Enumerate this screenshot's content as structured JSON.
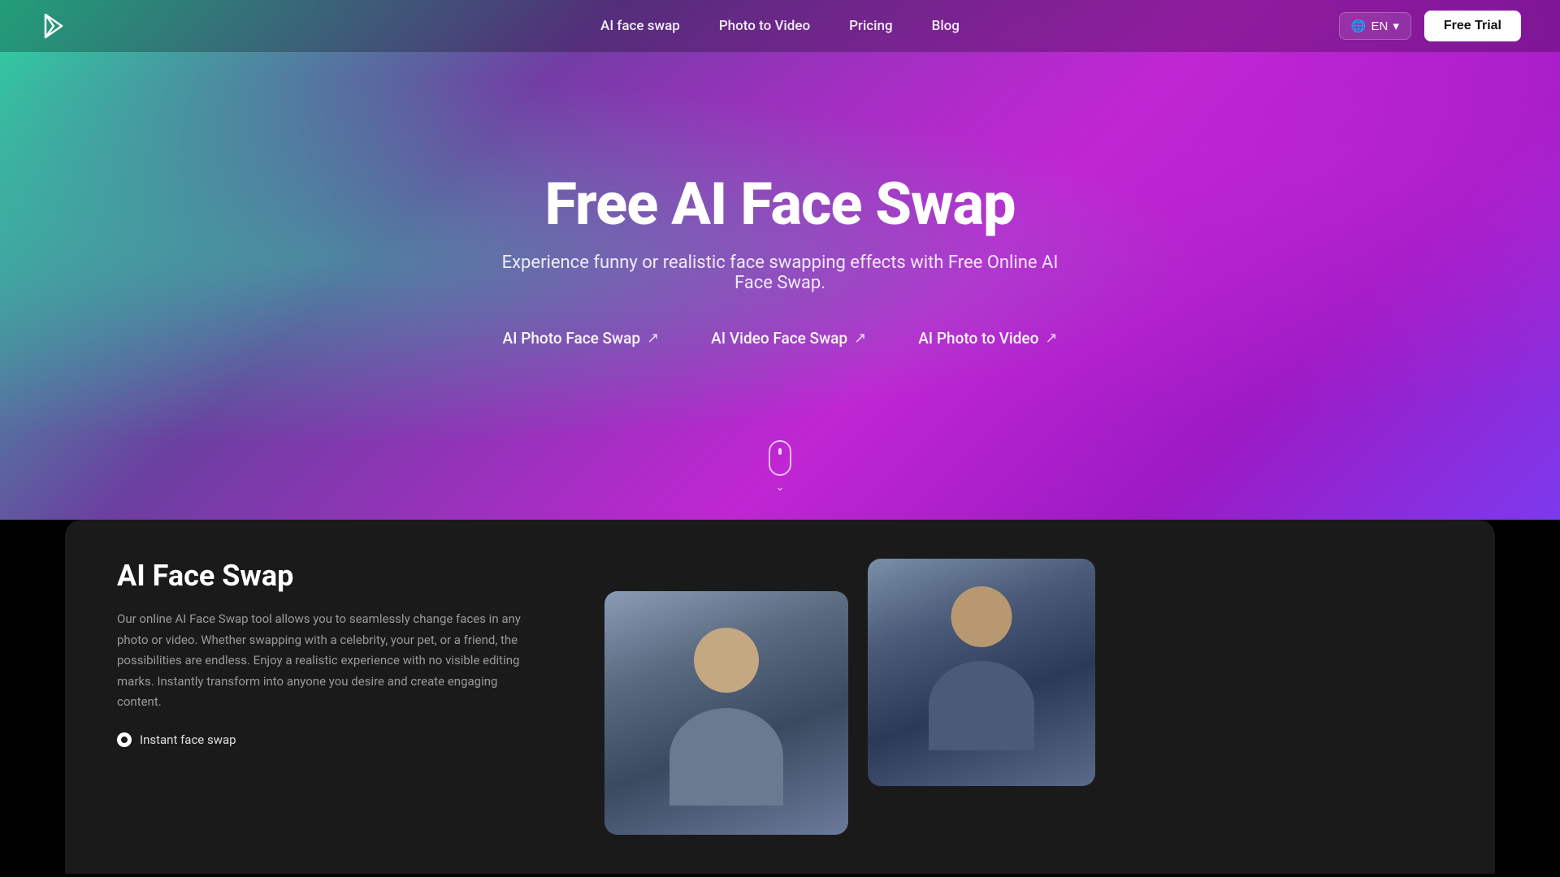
{
  "nav": {
    "logo_alt": "Brand Logo",
    "links": [
      {
        "id": "ai-face-swap",
        "label": "AI face swap"
      },
      {
        "id": "photo-to-video",
        "label": "Photo to Video"
      },
      {
        "id": "pricing",
        "label": "Pricing"
      },
      {
        "id": "blog",
        "label": "Blog"
      }
    ],
    "lang_label": "EN",
    "free_trial_label": "Free Trial"
  },
  "hero": {
    "title": "Free AI Face Swap",
    "subtitle": "Experience funny or realistic face swapping effects with Free Online AI Face Swap.",
    "links": [
      {
        "id": "ai-photo-face-swap",
        "label": "AI Photo Face Swap",
        "arrow": "↗"
      },
      {
        "id": "ai-video-face-swap",
        "label": "AI Video Face Swap",
        "arrow": "↗"
      },
      {
        "id": "ai-photo-to-video",
        "label": "AI Photo to Video",
        "arrow": "↗"
      }
    ]
  },
  "main_section": {
    "face_swap": {
      "title": "AI Face Swap",
      "description": "Our online AI Face Swap tool allows you to seamlessly change faces in any photo or video. Whether swapping with a celebrity, your pet, or a friend, the possibilities are endless. Enjoy a realistic experience with no visible editing marks. Instantly transform into anyone you desire and create engaging content.",
      "features": [
        {
          "id": "instant-face-swap",
          "label": "Instant face swap"
        }
      ]
    }
  },
  "colors": {
    "hero_gradient_start": "#2dd4a0",
    "hero_gradient_mid": "#c026d3",
    "hero_gradient_end": "#7c3aed",
    "nav_bg": "rgba(0,0,0,0.25)",
    "main_bg": "#1a1a1a",
    "text_primary": "#ffffff",
    "text_muted": "rgba(255,255,255,0.55)"
  }
}
